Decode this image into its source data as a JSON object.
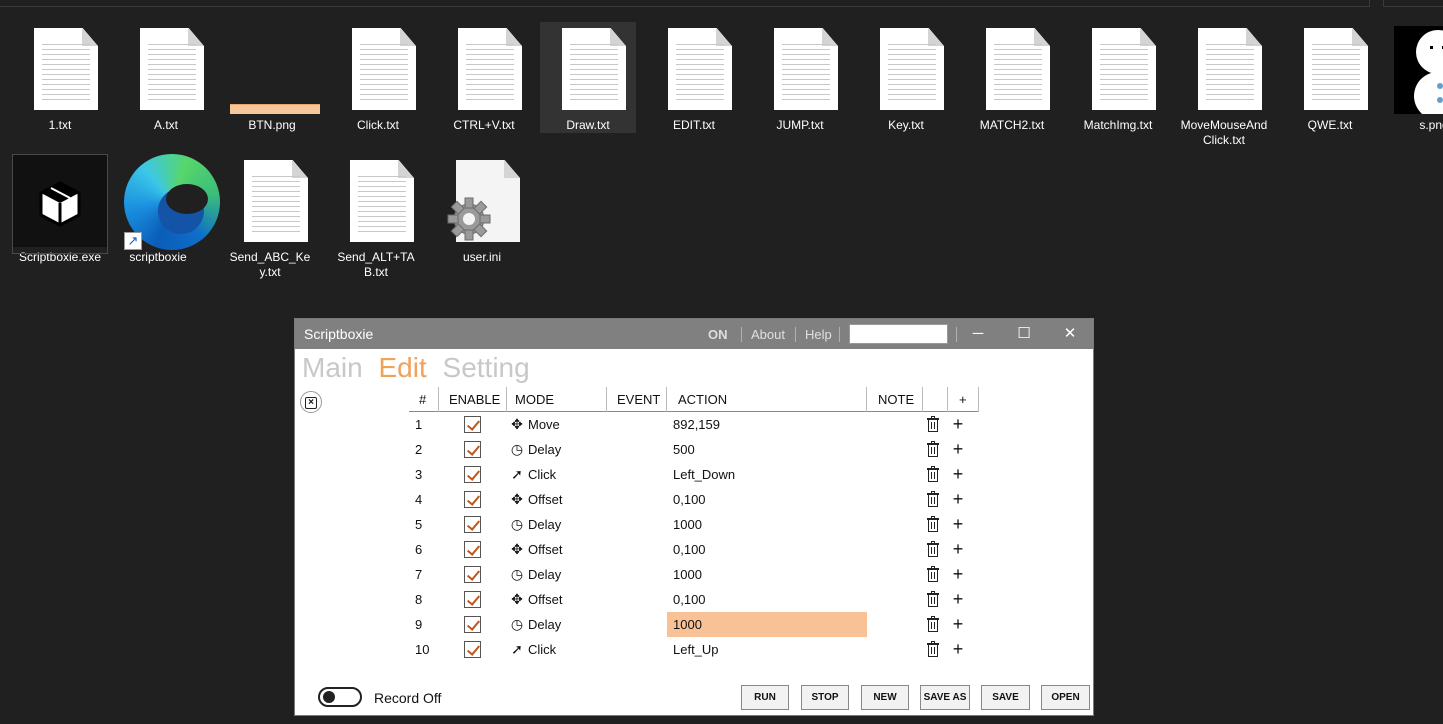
{
  "explorer": {
    "row1": [
      {
        "name": "1.txt",
        "icon": "text-file-icon"
      },
      {
        "name": "A.txt",
        "icon": "text-file-icon"
      },
      {
        "name": "BTN.png",
        "icon": "image-file-icon"
      },
      {
        "name": "Click.txt",
        "icon": "text-file-icon"
      },
      {
        "name": "CTRL+V.txt",
        "icon": "text-file-icon"
      },
      {
        "name": "Draw.txt",
        "icon": "text-file-icon"
      },
      {
        "name": "EDIT.txt",
        "icon": "text-file-icon"
      },
      {
        "name": "JUMP.txt",
        "icon": "text-file-icon"
      },
      {
        "name": "Key.txt",
        "icon": "text-file-icon"
      },
      {
        "name": "MATCH2.txt",
        "icon": "text-file-icon"
      },
      {
        "name": "MatchImg.txt",
        "icon": "text-file-icon"
      },
      {
        "name": "MoveMouseAndClick.txt",
        "icon": "text-file-icon"
      },
      {
        "name": "QWE.txt",
        "icon": "text-file-icon"
      },
      {
        "name": "s.png",
        "icon": "snowman-image-icon"
      }
    ],
    "row2": [
      {
        "name": "Scriptboxie.exe",
        "icon": "box-app-icon"
      },
      {
        "name": "scriptboxie",
        "icon": "edge-shortcut-icon"
      },
      {
        "name": "Send_ABC_Key.txt",
        "icon": "text-file-icon"
      },
      {
        "name": "Send_ALT+TAB.txt",
        "icon": "text-file-icon"
      },
      {
        "name": "user.ini",
        "icon": "settings-file-icon"
      }
    ],
    "selected": "Draw.txt"
  },
  "window": {
    "title": "Scriptboxie",
    "status": "ON",
    "about": "About",
    "help": "Help",
    "search_value": "",
    "minimize": "─",
    "maximize": "☐",
    "close": "✕"
  },
  "nav": {
    "main": "Main",
    "edit": "Edit",
    "setting": "Setting",
    "active": "Edit"
  },
  "table": {
    "headers": {
      "num": "#",
      "enable": "ENABLE",
      "mode": "MODE",
      "event": "EVENT",
      "action": "ACTION",
      "note": "NOTE",
      "delete": "",
      "add": "+"
    },
    "rows": [
      {
        "num": "1",
        "enabled": true,
        "mode": "Move",
        "mode_icon": "move-icon",
        "event": "",
        "action": "892,159",
        "note": ""
      },
      {
        "num": "2",
        "enabled": true,
        "mode": "Delay",
        "mode_icon": "clock-icon",
        "event": "",
        "action": "500",
        "note": ""
      },
      {
        "num": "3",
        "enabled": true,
        "mode": "Click",
        "mode_icon": "cursor-icon",
        "event": "",
        "action": "Left_Down",
        "note": ""
      },
      {
        "num": "4",
        "enabled": true,
        "mode": "Offset",
        "mode_icon": "move-icon",
        "event": "",
        "action": "0,100",
        "note": ""
      },
      {
        "num": "5",
        "enabled": true,
        "mode": "Delay",
        "mode_icon": "clock-icon",
        "event": "",
        "action": "1000",
        "note": ""
      },
      {
        "num": "6",
        "enabled": true,
        "mode": "Offset",
        "mode_icon": "move-icon",
        "event": "",
        "action": "0,100",
        "note": ""
      },
      {
        "num": "7",
        "enabled": true,
        "mode": "Delay",
        "mode_icon": "clock-icon",
        "event": "",
        "action": "1000",
        "note": ""
      },
      {
        "num": "8",
        "enabled": true,
        "mode": "Offset",
        "mode_icon": "move-icon",
        "event": "",
        "action": "0,100",
        "note": ""
      },
      {
        "num": "9",
        "enabled": true,
        "mode": "Delay",
        "mode_icon": "clock-icon",
        "event": "",
        "action": "1000",
        "note": "",
        "highlighted": true
      },
      {
        "num": "10",
        "enabled": true,
        "mode": "Click",
        "mode_icon": "cursor-icon",
        "event": "",
        "action": "Left_Up",
        "note": ""
      }
    ]
  },
  "footer": {
    "record_label": "Record Off",
    "record_on": false,
    "buttons": {
      "run": "RUN",
      "stop": "STOP",
      "new": "NEW",
      "save_as": "SAVE AS",
      "save": "SAVE",
      "open": "OPEN"
    }
  },
  "colors": {
    "accent": "#f0a15c",
    "highlight": "#f9c196",
    "check": "#c0561a",
    "titlebar": "#808080"
  }
}
